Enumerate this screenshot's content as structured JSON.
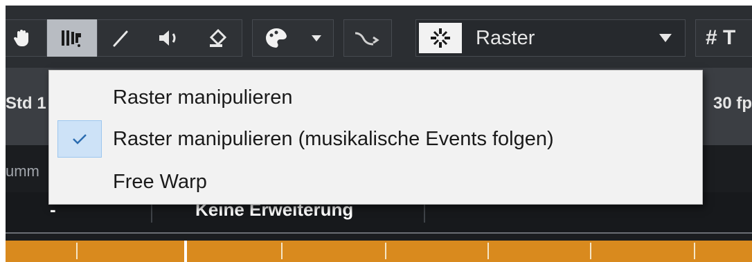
{
  "toolbar": {
    "tools": [
      {
        "name": "hand-tool",
        "icon": "hand-icon"
      },
      {
        "name": "warp-tool",
        "icon": "warp-grid-icon",
        "active": true
      },
      {
        "name": "draw-tool",
        "icon": "pencil-icon"
      },
      {
        "name": "listen-tool",
        "icon": "speaker-icon"
      },
      {
        "name": "color-tool",
        "icon": "paint-bucket-icon"
      },
      {
        "name": "fill-mode",
        "icon": "palette-icon"
      },
      {
        "name": "warp-curve",
        "icon": "curve-icon"
      }
    ],
    "snap_mode_icon": "snap-to-grid-icon",
    "snap_value": "Raster",
    "grid_label": "# T"
  },
  "info": {
    "left_text": "Std 1",
    "right_text": "30 fp",
    "sub_label": "umm",
    "track_left_value": "-",
    "track_value": "Keine Erweiterung"
  },
  "menu": {
    "items": [
      {
        "label": "Raster manipulieren",
        "checked": false
      },
      {
        "label": "Raster manipulieren (musikalische Events folgen)",
        "checked": true
      },
      {
        "label": "Free Warp",
        "checked": false
      }
    ]
  },
  "colors": {
    "toolbar_bg": "#2b2e32",
    "accent_check": "#cde2f7",
    "ruler": "#d98a1e"
  }
}
